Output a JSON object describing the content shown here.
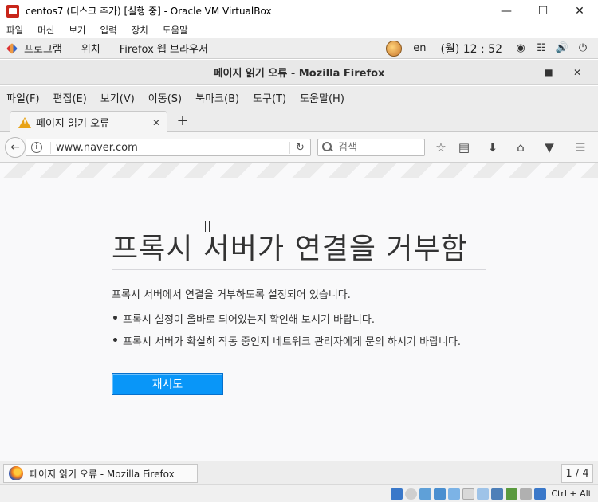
{
  "vbox": {
    "title": "centos7 (디스크 추가) [실행 중] - Oracle VM VirtualBox",
    "menu": [
      "파일",
      "머신",
      "보기",
      "입력",
      "장치",
      "도움말"
    ],
    "host_key": "Ctrl + Alt"
  },
  "gnome_panel": {
    "apps": "프로그램",
    "places": "위치",
    "active_app": "Firefox 웹 브라우저",
    "lang": "en",
    "clock": "(월) 12 : 52"
  },
  "firefox": {
    "window_title": "페이지 읽기 오류 - Mozilla Firefox",
    "menu": [
      "파일(F)",
      "편집(E)",
      "보기(V)",
      "이동(S)",
      "북마크(B)",
      "도구(T)",
      "도움말(H)"
    ],
    "tab_label": "페이지 읽기 오류",
    "url": "www.naver.com",
    "search_placeholder": "검색"
  },
  "error_page": {
    "title": "프록시 서버가 연결을 거부함",
    "description": "프록시 서버에서 연결을 거부하도록 설정되어 있습니다.",
    "items": [
      "프록시 설정이 올바로 되어있는지 확인해 보시기 바랍니다.",
      "프록시 서버가 확실히 작동 중인지 네트워크 관리자에게 문의 하시기 바랍니다."
    ],
    "retry_label": "재시도"
  },
  "taskbar": {
    "task_label": "페이지 읽기 오류 - Mozilla Firefox",
    "workspace": "1 / 4"
  },
  "colors": {
    "retry_button": "#0996f8",
    "warning": "#e8a317",
    "page_background": "#f9f9fa"
  }
}
